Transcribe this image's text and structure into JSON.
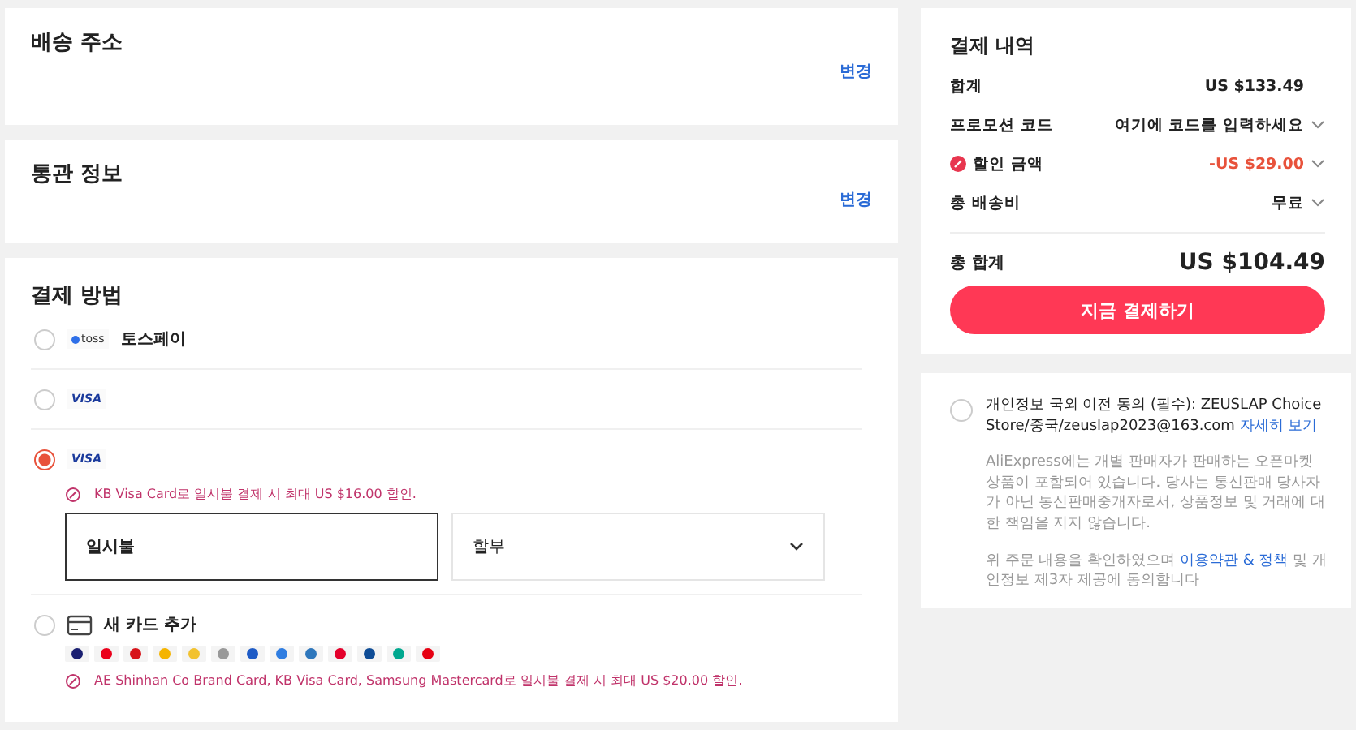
{
  "shipping": {
    "title": "배송 주소",
    "action": "변경"
  },
  "customs": {
    "title": "통관 정보",
    "action": "변경"
  },
  "payment": {
    "title": "결제 방법",
    "methods": [
      {
        "kind": "toss",
        "logo": "toss",
        "label": "토스페이",
        "selected": false
      },
      {
        "kind": "card",
        "logo": "VISA",
        "selected": false
      },
      {
        "kind": "card",
        "logo": "VISA",
        "selected": true,
        "promo": "KB Visa Card로 일시불 결제 시 최대 US $16.00 할인.",
        "installments": [
          {
            "kind": "option",
            "label": "일시불",
            "selected": true
          },
          {
            "kind": "dropdown",
            "label": "할부",
            "selected": false
          }
        ]
      },
      {
        "kind": "new_card",
        "label": "새 카드 추가",
        "selected": false,
        "promo": "AE Shinhan Co Brand Card, KB Visa Card, Samsung Mastercard로 일시불 결제 시 최대 US $20.00 할인."
      }
    ]
  },
  "summary": {
    "title": "결제 내역",
    "rows": [
      {
        "kind": "plain",
        "label": "합계",
        "value": "US $133.49",
        "chevron": false
      },
      {
        "kind": "plain",
        "label": "프로모션 코드",
        "value": "여기에 코드를 입력하세요",
        "chevron": true
      },
      {
        "kind": "discount",
        "label": "할인 금액",
        "value": "-US $29.00",
        "chevron": true
      },
      {
        "kind": "plain",
        "label": "총 배송비",
        "value": "무료",
        "chevron": true
      }
    ],
    "total_label": "총 합계",
    "total": "US $104.49",
    "pay_button": "지금 결제하기"
  },
  "consent": {
    "checked": false,
    "text": "개인정보 국외 이전 동의 (필수): ZEUSLAP Choice Store/중국/zeuslap2023@163.com",
    "link": "자세히 보기",
    "notice": "AliExpress에는 개별 판매자가 판매하는 오픈마켓 상품이 포함되어 있습니다. 당사는 통신판매 당사자가 아닌 통신판매중개자로서, 상품정보 및 거래에 대한 책임을 지지 않습니다.",
    "agree_before": "위 주문 내용을 확인하였으며",
    "agree_link": "이용약관 & 정책",
    "agree_after": "및 개인정보 제3자 제공에 동의합니다"
  }
}
